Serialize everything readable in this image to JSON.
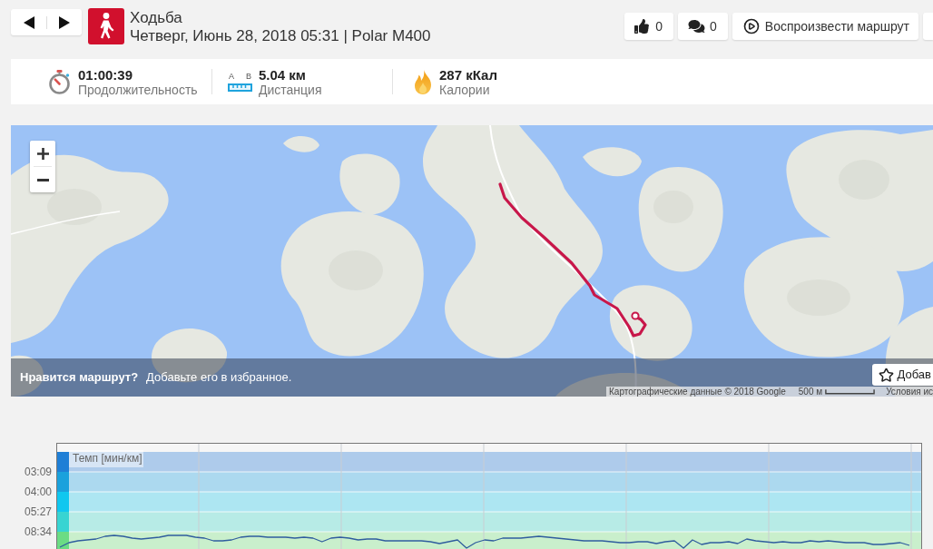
{
  "activity": {
    "title": "Ходьба",
    "subtitle": "Четверг, Июнь 28, 2018 05:31 | Polar M400"
  },
  "actions": [
    {
      "kind": "like",
      "label": "0"
    },
    {
      "kind": "comment",
      "label": "0"
    },
    {
      "kind": "replay",
      "label": "Воспроизвести маршрут"
    },
    {
      "kind": "cut_off"
    }
  ],
  "stats": [
    {
      "kind": "duration",
      "value": "01:00:39",
      "label": "Продолжительность"
    },
    {
      "kind": "distance",
      "value": "5.04 км",
      "label": "Дистанция",
      "icon_letters": [
        "A",
        "B"
      ]
    },
    {
      "kind": "calories",
      "value": "287 кКал",
      "label": "Калории"
    }
  ],
  "map": {
    "banner": {
      "title": "Нравится маршрут?",
      "text": "Добавьте его в избранное.",
      "button": "Добав"
    },
    "attribution": {
      "data": "Картографические данные © 2018 Google",
      "scale": "500 м",
      "terms": "Условия ис"
    }
  },
  "pace_chart": {
    "legend": "Темп [мин/км]",
    "axis_labels": [
      "03:09",
      "04:00",
      "05:27",
      "08:34"
    ]
  }
}
